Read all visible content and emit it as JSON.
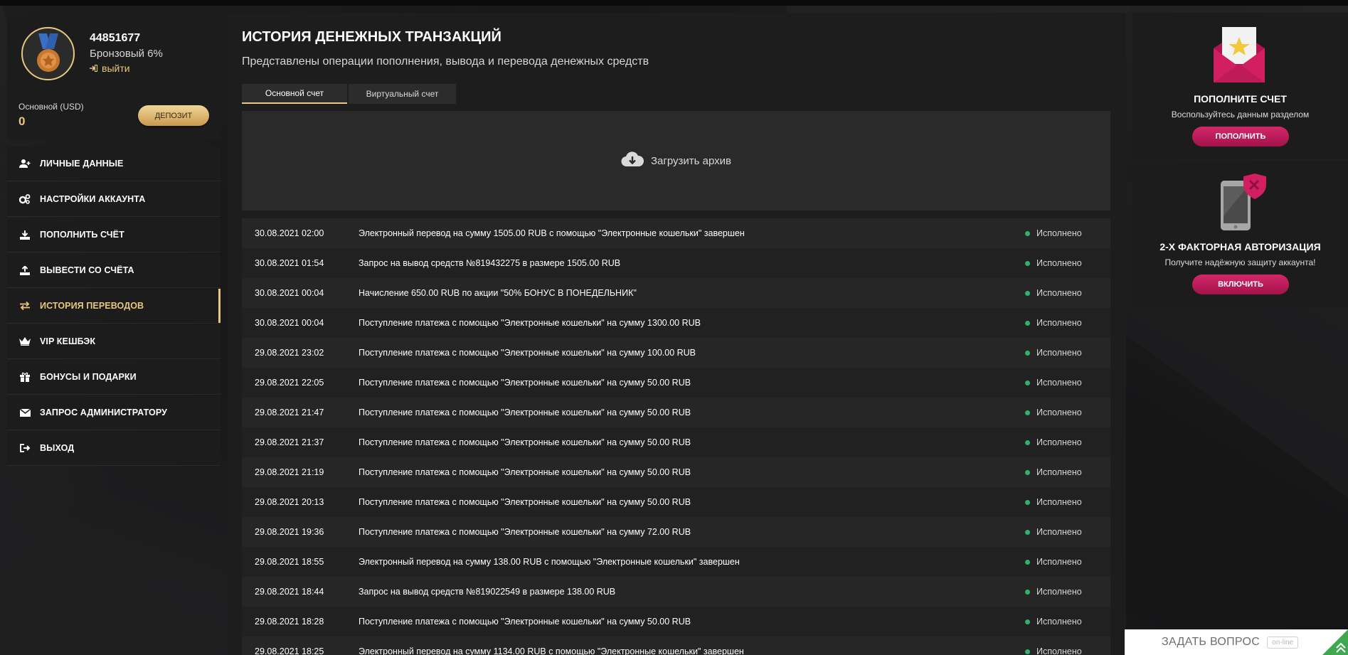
{
  "user": {
    "id": "44851677",
    "level": "Бронзовый 6%",
    "logout_label": "выйти",
    "balance_label": "Основной (USD)",
    "balance_value": "0",
    "deposit_label": "ДЕПОЗИТ"
  },
  "menu": [
    {
      "label": "ЛИЧНЫЕ ДАННЫЕ",
      "icon": "user-plus-icon"
    },
    {
      "label": "НАСТРОЙКИ АККАУНТА",
      "icon": "gears-icon"
    },
    {
      "label": "ПОПОЛНИТЬ СЧЁТ",
      "icon": "download-icon"
    },
    {
      "label": "ВЫВЕСТИ СО СЧЁТА",
      "icon": "upload-icon"
    },
    {
      "label": "ИСТОРИЯ ПЕРЕВОДОВ",
      "icon": "exchange-icon",
      "active": true
    },
    {
      "label": "VIP КЕШБЭК",
      "icon": "crown-icon"
    },
    {
      "label": "БОНУСЫ И ПОДАРКИ",
      "icon": "gift-icon"
    },
    {
      "label": "ЗАПРОС АДМИНИСТРАТОРУ",
      "icon": "envelope-icon"
    },
    {
      "label": "ВЫХОД",
      "icon": "sign-out-icon"
    }
  ],
  "main": {
    "title": "ИСТОРИЯ ДЕНЕЖНЫХ ТРАНЗАКЦИЙ",
    "subtitle": "Представлены операции пополнения, вывода и перевода денежных средств",
    "tabs": [
      "Основной счет",
      "Виртуальный счет"
    ],
    "archive_label": "Загрузить архив"
  },
  "transactions": [
    {
      "date": "30.08.2021 02:00",
      "desc": "Электронный перевод на сумму 1505.00 RUB с помощью \"Электронные кошельки\" завершен",
      "status": "Исполнено"
    },
    {
      "date": "30.08.2021 01:54",
      "desc": "Запрос на вывод средств №819432275 в размере 1505.00 RUB",
      "status": "Исполнено"
    },
    {
      "date": "30.08.2021 00:04",
      "desc": "Начисление 650.00 RUB по акции \"50% БОНУС В ПОНЕДЕЛЬНИК\"",
      "status": "Исполнено"
    },
    {
      "date": "30.08.2021 00:04",
      "desc": "Поступление платежа с помощью \"Электронные кошельки\" на сумму 1300.00 RUB",
      "status": "Исполнено"
    },
    {
      "date": "29.08.2021 23:02",
      "desc": "Поступление платежа с помощью \"Электронные кошельки\" на сумму 100.00 RUB",
      "status": "Исполнено"
    },
    {
      "date": "29.08.2021 22:05",
      "desc": "Поступление платежа с помощью \"Электронные кошельки\" на сумму 50.00 RUB",
      "status": "Исполнено"
    },
    {
      "date": "29.08.2021 21:47",
      "desc": "Поступление платежа с помощью \"Электронные кошельки\" на сумму 50.00 RUB",
      "status": "Исполнено"
    },
    {
      "date": "29.08.2021 21:37",
      "desc": "Поступление платежа с помощью \"Электронные кошельки\" на сумму 50.00 RUB",
      "status": "Исполнено"
    },
    {
      "date": "29.08.2021 21:19",
      "desc": "Поступление платежа с помощью \"Электронные кошельки\" на сумму 50.00 RUB",
      "status": "Исполнено"
    },
    {
      "date": "29.08.2021 20:13",
      "desc": "Поступление платежа с помощью \"Электронные кошельки\" на сумму 50.00 RUB",
      "status": "Исполнено"
    },
    {
      "date": "29.08.2021 19:36",
      "desc": "Поступление платежа с помощью \"Электронные кошельки\" на сумму 72.00 RUB",
      "status": "Исполнено"
    },
    {
      "date": "29.08.2021 18:55",
      "desc": "Электронный перевод на сумму 138.00 RUB с помощью \"Электронные кошельки\" завершен",
      "status": "Исполнено"
    },
    {
      "date": "29.08.2021 18:44",
      "desc": "Запрос на вывод средств №819022549 в размере 138.00 RUB",
      "status": "Исполнено"
    },
    {
      "date": "29.08.2021 18:28",
      "desc": "Поступление платежа с помощью \"Электронные кошельки\" на сумму 50.00 RUB",
      "status": "Исполнено"
    },
    {
      "date": "29.08.2021 18:25",
      "desc": "Электронный перевод на сумму 1134.00 RUB с помощью \"Электронные кошельки\" завершен",
      "status": "Исполнено"
    }
  ],
  "promos": [
    {
      "title": "ПОПОЛНИТЕ СЧЕТ",
      "text": "Воспользуйтесь данным разделом",
      "button": "ПОПОЛНИТЬ",
      "icon": "envelope-star-icon"
    },
    {
      "title": "2-Х ФАКТОРНАЯ АВТОРИЗАЦИЯ",
      "text": "Получите надёжную защиту аккаунта!",
      "button": "ВКЛЮЧИТЬ",
      "icon": "phone-shield-icon"
    }
  ],
  "chat": {
    "label": "ЗАДАТЬ ВОПРОС",
    "badge": "on-line"
  },
  "colors": {
    "accent": "#e8c77e",
    "promo_button": "#c81c5e",
    "status_ok": "#2fb36a"
  }
}
